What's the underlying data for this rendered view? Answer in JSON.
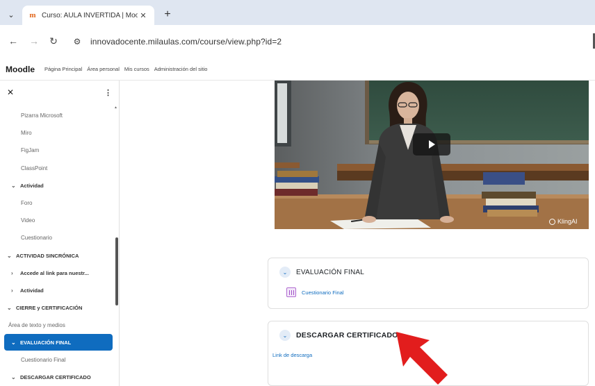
{
  "browser": {
    "tab_title": "Curso: AULA INVERTIDA | Moo",
    "url": "innovadocente.milaulas.com/course/view.php?id=2"
  },
  "navbar": {
    "brand": "Moodle",
    "links": [
      "Página Principal",
      "Área personal",
      "Mis cursos",
      "Administración del sitio"
    ]
  },
  "drawer": {
    "items": [
      {
        "label": "Pizarra Microsoft"
      },
      {
        "label": "Miro"
      },
      {
        "label": "FigJam"
      },
      {
        "label": "ClassPoint"
      },
      {
        "label": "Actividad"
      },
      {
        "label": "Foro"
      },
      {
        "label": "Video"
      },
      {
        "label": "Cuestionario"
      },
      {
        "label": "ACTIVIDAD SINCRÓNICA"
      },
      {
        "label": "Accede al link para nuestr..."
      },
      {
        "label": "Actividad"
      },
      {
        "label": "CIERRE y CERTIFICACIÓN"
      },
      {
        "label": "Área de texto y medios"
      },
      {
        "label": "EVALUACIÓN FINAL"
      },
      {
        "label": "Cuestionario Final"
      },
      {
        "label": "DESCARGAR CERTIFICADO"
      }
    ]
  },
  "video": {
    "watermark": "KlingAI"
  },
  "sections": {
    "evaluacion": {
      "title": "EVALUACIÓN FINAL",
      "activity": "Cuestionario Final"
    },
    "certificado": {
      "title": "DESCARGAR CERTIFICADO",
      "link": "Link de descarga"
    }
  },
  "colors": {
    "primary": "#0f6cbf",
    "arrow": "#e21d1d",
    "tabbar": "#dfe6f1"
  }
}
